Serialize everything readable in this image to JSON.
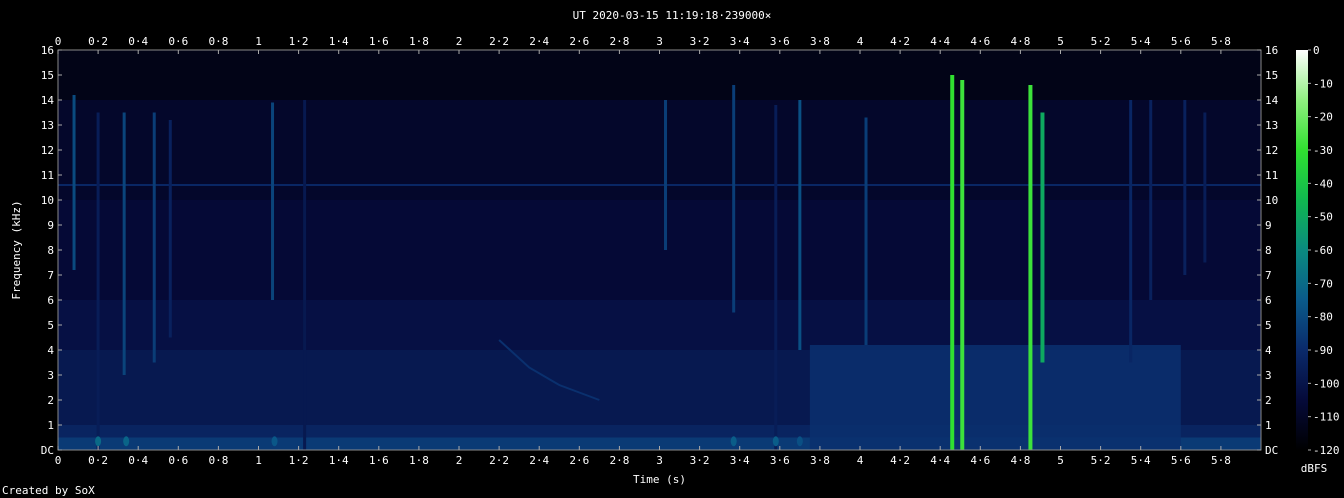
{
  "title": "UT 2020-03-15 11:19:18·239000×",
  "footer": "Created by SoX",
  "chart_data": {
    "type": "heatmap",
    "title": "UT 2020-03-15 11:19:18·239000×",
    "xlabel": "Time (s)",
    "ylabel": "Frequency (kHz)",
    "xlim": [
      0,
      6
    ],
    "ylim": [
      0,
      16
    ],
    "x_ticks": [
      "0",
      "0·2",
      "0·4",
      "0·6",
      "0·8",
      "1",
      "1·2",
      "1·4",
      "1·6",
      "1·8",
      "2",
      "2·2",
      "2·4",
      "2·6",
      "2·8",
      "3",
      "3·2",
      "3·4",
      "3·6",
      "3·8",
      "4",
      "4·2",
      "4·4",
      "4·6",
      "4·8",
      "5",
      "5·2",
      "5·4",
      "5·6",
      "5·8"
    ],
    "y_ticks": [
      "DC",
      "1",
      "2",
      "3",
      "4",
      "5",
      "6",
      "7",
      "8",
      "9",
      "10",
      "11",
      "12",
      "13",
      "14",
      "15",
      "16"
    ],
    "colorbar": {
      "label": "dBFS",
      "range": [
        -120,
        0
      ],
      "ticks": [
        "0",
        "-10",
        "-20",
        "-30",
        "-40",
        "-50",
        "-60",
        "-70",
        "-80",
        "-90",
        "-100",
        "-110",
        "-120"
      ],
      "colors": [
        "#000000",
        "#050a3a",
        "#0a2a6a",
        "#0a5a8a",
        "#0a8a80",
        "#10b850",
        "#30e030",
        "#90f080",
        "#ffffff"
      ]
    },
    "background_level_db": -112,
    "noise_floor": [
      {
        "f0": 0,
        "f1": 0.5,
        "db": -85
      },
      {
        "f0": 0.5,
        "f1": 1,
        "db": -93
      },
      {
        "f0": 1,
        "f1": 4,
        "db": -98
      },
      {
        "f0": 4,
        "f1": 6,
        "db": -102
      },
      {
        "f0": 6,
        "f1": 10,
        "db": -106
      },
      {
        "f0": 10,
        "f1": 14,
        "db": -109
      },
      {
        "f0": 14,
        "f1": 16,
        "db": -114
      }
    ],
    "tone_line": {
      "freq_khz": 10.6,
      "db": -92
    },
    "broadband_region": {
      "t0": 3.75,
      "t1": 5.6,
      "f0": 0,
      "f1": 4.2,
      "db": -88
    },
    "sweep": {
      "points": [
        [
          2.2,
          4.4
        ],
        [
          2.35,
          3.3
        ],
        [
          2.5,
          2.6
        ],
        [
          2.7,
          2.0
        ]
      ],
      "db": -88
    },
    "transients": [
      {
        "t": 0.08,
        "f0": 7.2,
        "f1": 14.2,
        "db": -80
      },
      {
        "t": 0.2,
        "f0": 0,
        "f1": 13.5,
        "db": -96
      },
      {
        "t": 0.33,
        "f0": 3.0,
        "f1": 13.5,
        "db": -82
      },
      {
        "t": 0.48,
        "f0": 3.5,
        "f1": 13.5,
        "db": -84
      },
      {
        "t": 0.56,
        "f0": 4.5,
        "f1": 13.2,
        "db": -94
      },
      {
        "t": 1.07,
        "f0": 6.0,
        "f1": 13.9,
        "db": -82
      },
      {
        "t": 1.23,
        "f0": 0,
        "f1": 14.0,
        "db": -98
      },
      {
        "t": 3.03,
        "f0": 8.0,
        "f1": 14.0,
        "db": -84
      },
      {
        "t": 3.37,
        "f0": 5.5,
        "f1": 14.6,
        "db": -84
      },
      {
        "t": 3.58,
        "f0": 0,
        "f1": 13.8,
        "db": -96
      },
      {
        "t": 3.7,
        "f0": 4.0,
        "f1": 14.0,
        "db": -78
      },
      {
        "t": 4.03,
        "f0": 4.2,
        "f1": 13.3,
        "db": -84
      },
      {
        "t": 4.46,
        "f0": 0,
        "f1": 15.0,
        "db": -30
      },
      {
        "t": 4.51,
        "f0": 0,
        "f1": 14.8,
        "db": -28
      },
      {
        "t": 4.85,
        "f0": 0,
        "f1": 14.6,
        "db": -28
      },
      {
        "t": 4.91,
        "f0": 3.5,
        "f1": 13.5,
        "db": -50
      },
      {
        "t": 5.35,
        "f0": 3.5,
        "f1": 14.0,
        "db": -92
      },
      {
        "t": 5.45,
        "f0": 6.0,
        "f1": 14.0,
        "db": -94
      },
      {
        "t": 5.62,
        "f0": 7.0,
        "f1": 14.0,
        "db": -94
      },
      {
        "t": 5.72,
        "f0": 7.5,
        "f1": 13.5,
        "db": -96
      }
    ],
    "low_frequency_blips": [
      {
        "t": 0.2,
        "db": -70
      },
      {
        "t": 0.34,
        "db": -72
      },
      {
        "t": 1.08,
        "db": -76
      },
      {
        "t": 3.37,
        "db": -74
      },
      {
        "t": 3.58,
        "db": -74
      },
      {
        "t": 3.7,
        "db": -78
      }
    ]
  }
}
